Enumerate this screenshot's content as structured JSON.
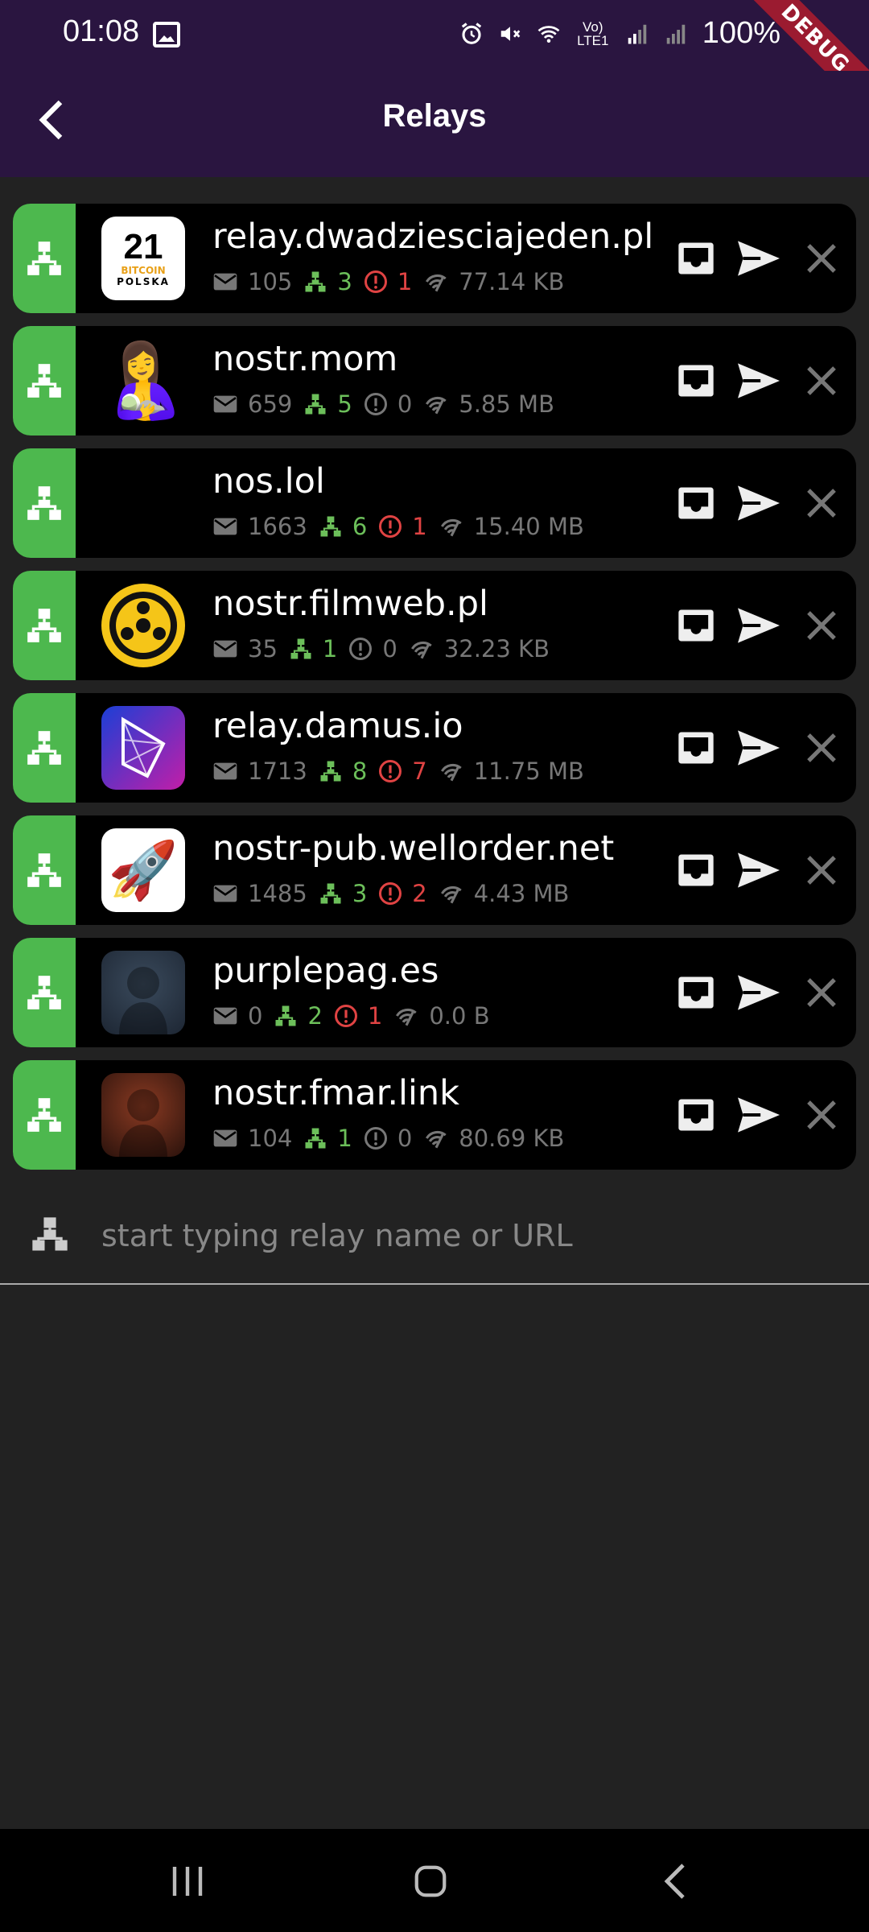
{
  "status_bar": {
    "time": "01:08",
    "battery": "100%",
    "network": "Vo) LTE1",
    "icons": [
      "gallery-icon",
      "alarm-icon",
      "mute-icon",
      "wifi-icon",
      "signal-icon",
      "signal-icon",
      "battery-icon"
    ]
  },
  "debug_banner": "DEBUG",
  "app_bar": {
    "title": "Relays",
    "back_icon": "chevron-left-icon"
  },
  "relays": [
    {
      "name": "relay.dwadziesciajeden.pl",
      "events": "105",
      "connections": "3",
      "errors": "1",
      "errors_color": "red",
      "traffic": "77.14 KB",
      "avatar": {
        "kind": "text",
        "big": "21",
        "line1": "BITCOIN",
        "line2": "POLSKA"
      }
    },
    {
      "name": "nostr.mom",
      "events": "659",
      "connections": "5",
      "errors": "0",
      "errors_color": "gray",
      "traffic": "5.85 MB",
      "avatar": {
        "kind": "emoji",
        "glyph": "🤱"
      }
    },
    {
      "name": "nos.lol",
      "events": "1663",
      "connections": "6",
      "errors": "1",
      "errors_color": "red",
      "traffic": "15.40 MB",
      "avatar": {
        "kind": "emoji",
        "glyph": "😸"
      }
    },
    {
      "name": "nostr.filmweb.pl",
      "events": "35",
      "connections": "1",
      "errors": "0",
      "errors_color": "gray",
      "traffic": "32.23 KB",
      "avatar": {
        "kind": "filmweb"
      }
    },
    {
      "name": "relay.damus.io",
      "events": "1713",
      "connections": "8",
      "errors": "7",
      "errors_color": "red",
      "traffic": "11.75 MB",
      "avatar": {
        "kind": "damus"
      }
    },
    {
      "name": "nostr-pub.wellorder.net",
      "events": "1485",
      "connections": "3",
      "errors": "2",
      "errors_color": "red",
      "traffic": "4.43 MB",
      "avatar": {
        "kind": "emoji",
        "glyph": "🚀"
      }
    },
    {
      "name": "purplepag.es",
      "events": "0",
      "connections": "2",
      "errors": "1",
      "errors_color": "red",
      "traffic": "0.0 B",
      "avatar": {
        "kind": "photo",
        "palette": [
          "#3a4a5c",
          "#1d2633"
        ]
      }
    },
    {
      "name": "nostr.fmar.link",
      "events": "104",
      "connections": "1",
      "errors": "0",
      "errors_color": "gray",
      "traffic": "80.69 KB",
      "avatar": {
        "kind": "photo",
        "palette": [
          "#8a3a22",
          "#2a120c"
        ]
      }
    }
  ],
  "add_relay": {
    "placeholder": "start typing relay name or URL"
  },
  "nav_bar": {
    "items": [
      "recent-apps-icon",
      "home-icon",
      "back-icon"
    ]
  },
  "colors": {
    "app_bar": "#2a1540",
    "background": "#222222",
    "card": "#000000",
    "connected": "#4db84e",
    "green_text": "#6cbf5a",
    "error": "#e04343"
  }
}
